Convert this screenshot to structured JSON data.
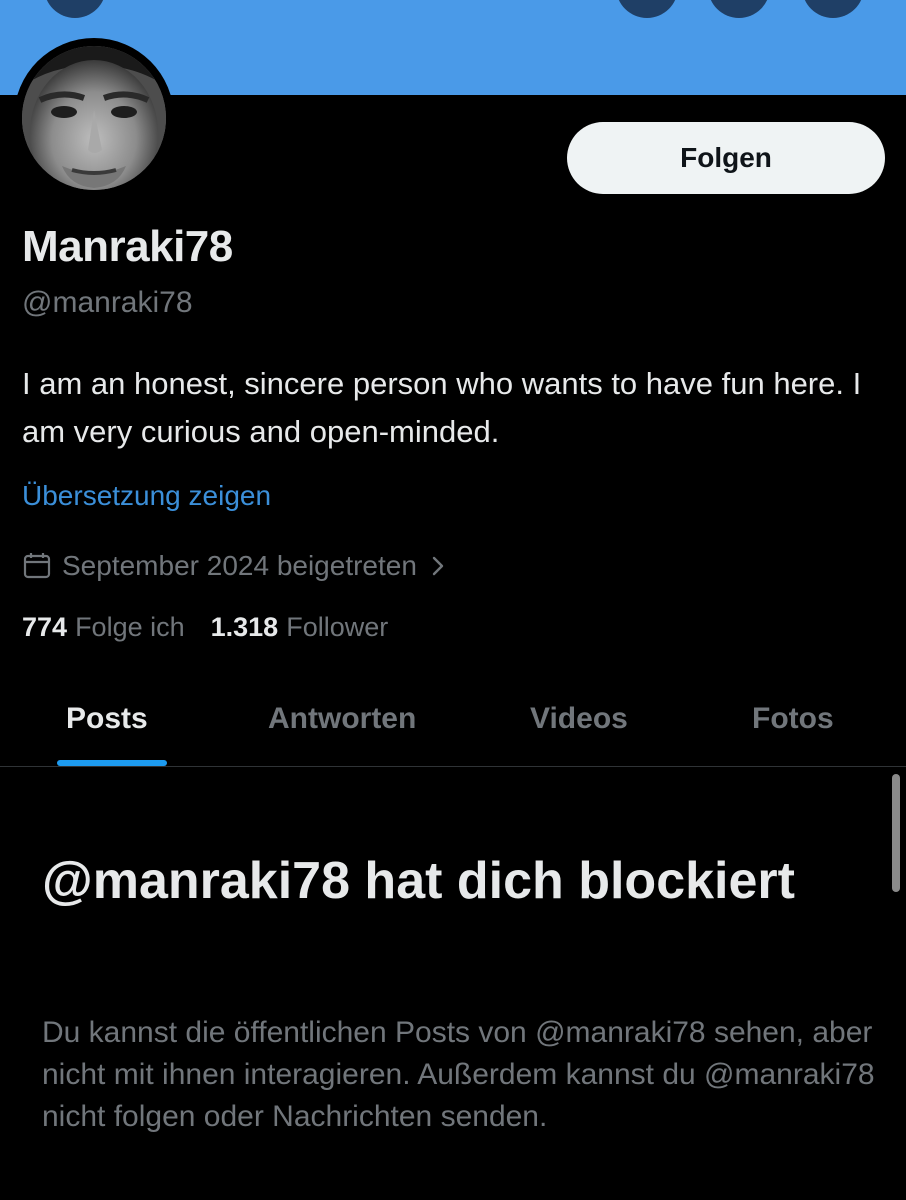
{
  "profile": {
    "display_name": "Manraki78",
    "handle": "@manraki78",
    "bio": "I am an honest, sincere person who wants to have fun here. I am very curious and open-minded.",
    "translate_label": "Übersetzung zeigen",
    "joined": "September 2024 beigetreten",
    "follow_label": "Folgen"
  },
  "stats": {
    "following_count": "774",
    "following_label": "Folge ich",
    "followers_count": "1.318",
    "followers_label": "Follower"
  },
  "tabs": [
    {
      "label": "Posts",
      "active": true
    },
    {
      "label": "Antworten",
      "active": false
    },
    {
      "label": "Videos",
      "active": false
    },
    {
      "label": "Fotos",
      "active": false
    }
  ],
  "blocked": {
    "title": "@manraki78 hat dich blockiert",
    "description": "Du kannst die öffentlichen Posts von @manraki78 sehen, aber nicht mit ihnen interagieren. Außerdem kannst du @manraki78 nicht folgen oder Nachrichten senden."
  },
  "icons": {
    "joined": "calendar-icon",
    "joined_chevron": "chevron-right-icon"
  },
  "colors": {
    "banner": "#4a9ae8",
    "background": "#000000",
    "link": "#3b8fd9",
    "tab_indicator": "#1d9bf0",
    "muted_text": "#71767b",
    "follow_button_bg": "#eff3f4"
  }
}
